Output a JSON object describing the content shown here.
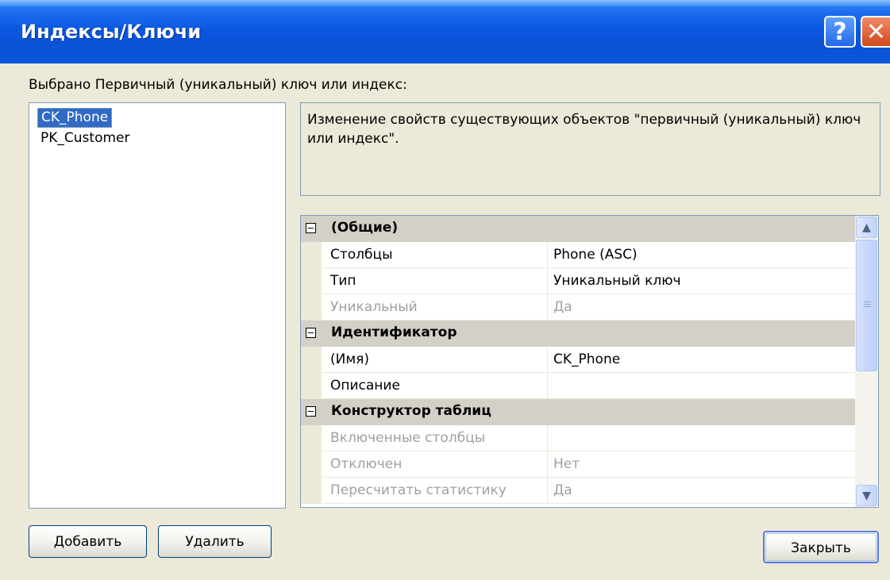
{
  "window": {
    "title": "Индексы/Ключи",
    "help_glyph": "?",
    "close_glyph": "✕",
    "icons": [
      "help-icon",
      "close-icon"
    ]
  },
  "selection": {
    "label": "Выбрано Первичный (уникальный) ключ или индекс:"
  },
  "list": {
    "items": [
      {
        "label": "CK_Phone",
        "selected": true
      },
      {
        "label": "PK_Customer",
        "selected": false
      }
    ]
  },
  "description": "Изменение свойств существующих объектов \"первичный (уникальный) ключ или индекс\".",
  "properties": {
    "categories": [
      {
        "label": "(Общие)",
        "rows": [
          {
            "name": "Столбцы",
            "value": "Phone (ASC)",
            "disabled": false
          },
          {
            "name": "Тип",
            "value": "Уникальный ключ",
            "disabled": false
          },
          {
            "name": "Уникальный",
            "value": "Да",
            "disabled": true
          }
        ]
      },
      {
        "label": "Идентификатор",
        "rows": [
          {
            "name": "(Имя)",
            "value": "CK_Phone",
            "disabled": false
          },
          {
            "name": "Описание",
            "value": "",
            "disabled": false
          }
        ]
      },
      {
        "label": "Конструктор таблиц",
        "rows": [
          {
            "name": "Включенные столбцы",
            "value": "",
            "disabled": true
          },
          {
            "name": "Отключен",
            "value": "Нет",
            "disabled": true
          },
          {
            "name": "Пересчитать статистику",
            "value": "Да",
            "disabled": true
          }
        ]
      }
    ],
    "scroll_up_glyph": "▲",
    "scroll_down_glyph": "▼"
  },
  "buttons": {
    "add": "Добавить",
    "delete": "Удалить",
    "close": "Закрыть"
  },
  "colors": {
    "title_bar": "#0b58e0",
    "selection": "#316ac5",
    "face": "#ece9d8"
  }
}
